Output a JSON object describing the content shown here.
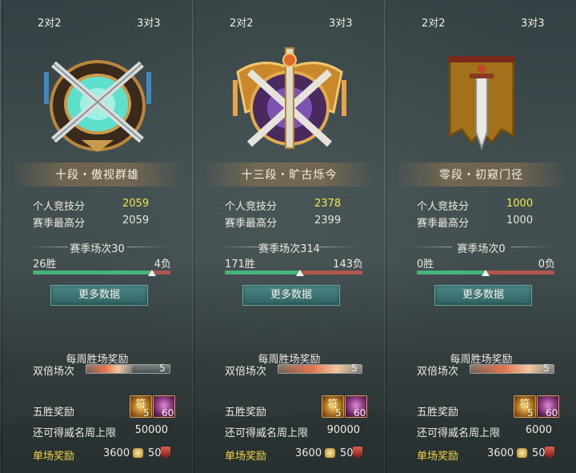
{
  "panels": [
    {
      "mode_tabs": [
        "2对2",
        "3对3"
      ],
      "emblem_icon": "tier-10-crossed-swords-emblem-icon",
      "rank_title": "十段・傲视群雄",
      "personal_score_label": "个人竞技分",
      "personal_score": "2059",
      "season_high_label": "赛季最高分",
      "season_high": "2059",
      "season_matches": "赛季场次30",
      "wins": "26胜",
      "losses": "4负",
      "win_ratio": 0.867,
      "more_data_label": "更多数据",
      "weekly_reward_title": "每周胜场奖励",
      "double_label": "双倍场次",
      "double_count": "5",
      "double_remaining_ratio": 0.55,
      "five_win_label": "五胜奖励",
      "reward_items": [
        {
          "icon": "rune-chest-icon",
          "qty": "5"
        },
        {
          "icon": "purple-scroll-icon",
          "qty": "60"
        }
      ],
      "cap_label": "还可得威名周上限",
      "cap_value": "50000",
      "single_label": "单场奖励",
      "single_coins": "3600",
      "single_honor": "50"
    },
    {
      "mode_tabs": [
        "2对2",
        "3对3"
      ],
      "emblem_icon": "tier-13-golden-winged-emblem-icon",
      "rank_title": "十三段・旷古烁今",
      "personal_score_label": "个人竞技分",
      "personal_score": "2378",
      "season_high_label": "赛季最高分",
      "season_high": "2399",
      "season_matches": "赛季场次314",
      "wins": "171胜",
      "losses": "143负",
      "win_ratio": 0.545,
      "more_data_label": "更多数据",
      "weekly_reward_title": "每周胜场奖励",
      "double_label": "双倍场次",
      "double_count": "5",
      "double_remaining_ratio": 1.0,
      "five_win_label": "五胜奖励",
      "reward_items": [
        {
          "icon": "rune-chest-icon",
          "qty": "5"
        },
        {
          "icon": "purple-scroll-icon",
          "qty": "60"
        }
      ],
      "cap_label": "还可得威名周上限",
      "cap_value": "90000",
      "single_label": "单场奖励",
      "single_coins": "3600",
      "single_honor": "50"
    },
    {
      "mode_tabs": [
        "2对2",
        "3对3"
      ],
      "emblem_icon": "tier-0-sword-banner-emblem-icon",
      "rank_title": "零段・初窥门径",
      "personal_score_label": "个人竞技分",
      "personal_score": "1000",
      "season_high_label": "赛季最高分",
      "season_high": "1000",
      "season_matches": "赛季场次0",
      "wins": "0胜",
      "losses": "0负",
      "win_ratio": 0.5,
      "more_data_label": "更多数据",
      "weekly_reward_title": "每周胜场奖励",
      "double_label": "双倍场次",
      "double_count": "5",
      "double_remaining_ratio": 1.0,
      "five_win_label": "五胜奖励",
      "reward_items": [
        {
          "icon": "rune-chest-icon",
          "qty": "5"
        },
        {
          "icon": "purple-scroll-icon",
          "qty": "60"
        }
      ],
      "cap_label": "还可得威名周上限",
      "cap_value": "6000",
      "single_label": "单场奖励",
      "single_coins": "3600",
      "single_honor": "50"
    }
  ],
  "colors": {
    "score_highlight": "#f2e54a",
    "single_reward_label": "#f3d641",
    "win_bar": "#45b37a",
    "loss_bar": "#b0574c",
    "button": "#3a7474"
  }
}
